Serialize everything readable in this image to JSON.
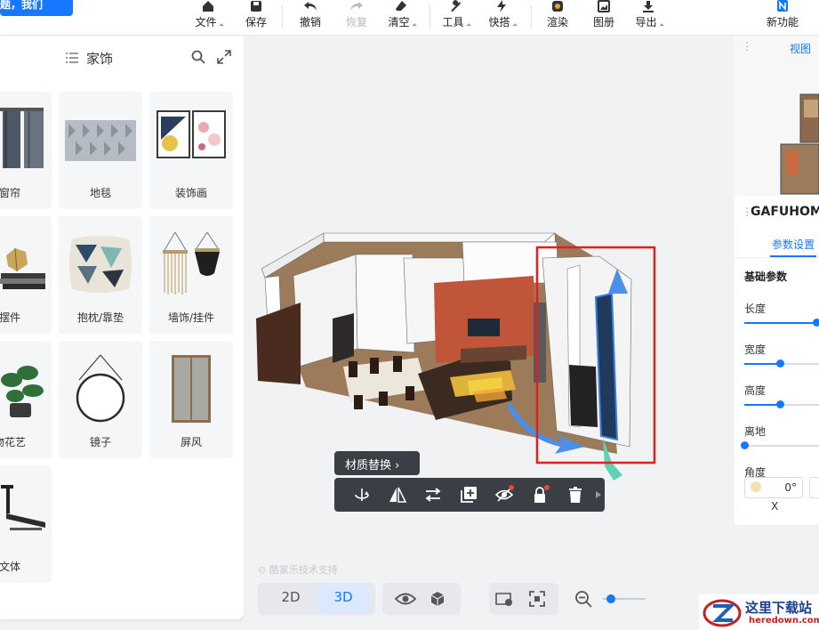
{
  "banner": {
    "text": "题，我们"
  },
  "toolbar": {
    "file": "文件",
    "save": "保存",
    "undo": "撤销",
    "redo": "恢复",
    "clear": "清空",
    "tools": "工具",
    "quick": "快搭",
    "render": "渲染",
    "gallery": "图册",
    "export": "导出",
    "new_feature": "新功能"
  },
  "library": {
    "title": "家饰",
    "items": [
      {
        "label": "窗帘"
      },
      {
        "label": "地毯"
      },
      {
        "label": "装饰画"
      },
      {
        "label": "摆件"
      },
      {
        "label": "抱枕/靠垫"
      },
      {
        "label": "墙饰/挂件"
      },
      {
        "label": "物花艺"
      },
      {
        "label": "镜子"
      },
      {
        "label": "屏风"
      },
      {
        "label": "文体"
      }
    ]
  },
  "viewport": {
    "material_button": "材质替换",
    "watermark": "酷家乐技术支持"
  },
  "bottom": {
    "mode_2d": "2D",
    "mode_3d": "3D",
    "active_mode": "3D"
  },
  "right_panel": {
    "view_label": "视图",
    "model_name": "GAFUHOM",
    "tab": "参数设置",
    "section": "基础参数",
    "params": [
      {
        "label": "长度",
        "level": 1.0
      },
      {
        "label": "宽度",
        "level": 0.5
      },
      {
        "label": "高度",
        "level": 0.5
      },
      {
        "label": "离地",
        "level": 0.0
      },
      {
        "label": "角度",
        "level": 0.0
      }
    ],
    "angle_value": "0°",
    "axis_x": "X"
  },
  "logo": {
    "text": "这里下载站",
    "url": "heredown.com"
  },
  "colors": {
    "accent": "#1677ff",
    "toolbar_dark": "#3b3e44",
    "highlight": "#e02020"
  }
}
